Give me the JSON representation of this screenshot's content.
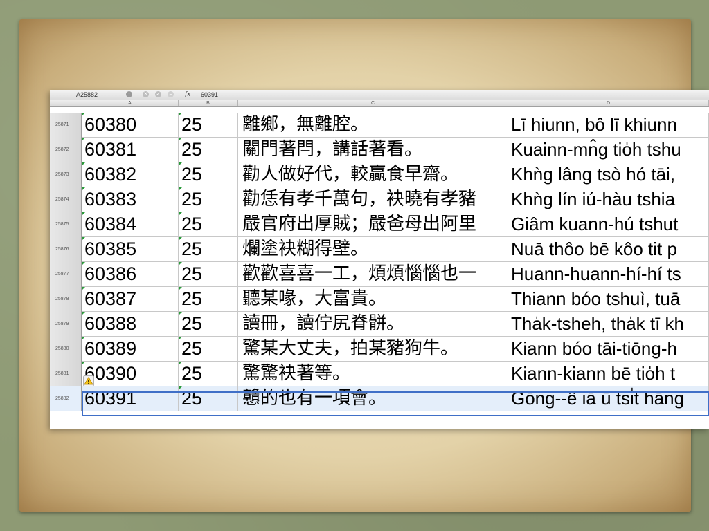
{
  "formula_bar": {
    "name_box": "A25882",
    "fx_label": "fx",
    "value": "60391"
  },
  "columns": [
    "A",
    "B",
    "C",
    "D"
  ],
  "rows": [
    {
      "num": "25871",
      "a": "60380",
      "b": "25",
      "c": "離鄉，無離腔。",
      "d": "Lī hiunn, bô lī khiunn"
    },
    {
      "num": "25872",
      "a": "60381",
      "b": "25",
      "c": "關門著閂，講話著看。",
      "d": "Kuainn-mn̂g tio̍h tshu"
    },
    {
      "num": "25873",
      "a": "60382",
      "b": "25",
      "c": "勸人做好代，較贏食早齋。",
      "d": "Khǹg lâng tsò hó tāi,"
    },
    {
      "num": "25874",
      "a": "60383",
      "b": "25",
      "c": "勸恁有孝千萬句，袂曉有孝豬",
      "d": "Khǹg lín iú-hàu tshia"
    },
    {
      "num": "25875",
      "a": "60384",
      "b": "25",
      "c": "嚴官府出厚賊；嚴爸母出阿里",
      "d": "Giâm kuann-hú tshut"
    },
    {
      "num": "25876",
      "a": "60385",
      "b": "25",
      "c": "爛塗袂糊得壁。",
      "d": "Nuā thôo bē kôo tit p"
    },
    {
      "num": "25877",
      "a": "60386",
      "b": "25",
      "c": "歡歡喜喜一工，煩煩惱惱也一",
      "d": "Huann-huann-hí-hí ts"
    },
    {
      "num": "25878",
      "a": "60387",
      "b": "25",
      "c": "聽某喙，大富貴。",
      "d": "Thiann bóo tshuì, tuā"
    },
    {
      "num": "25879",
      "a": "60388",
      "b": "25",
      "c": "讀冊，讀佇尻脊骿。",
      "d": "Tha̍k-tsheh, tha̍k tī kh"
    },
    {
      "num": "25880",
      "a": "60389",
      "b": "25",
      "c": "驚某大丈夫，拍某豬狗牛。",
      "d": "Kiann bóo tāi-tiōng-h"
    },
    {
      "num": "25881",
      "a": "60390",
      "b": "25",
      "c": "驚驚袂著等。",
      "d": "Kiann-kiann bē tio̍h t"
    },
    {
      "num": "25882",
      "a": "60391",
      "b": "25",
      "c": "戇的也有一項會。",
      "d": "Gōng--ê iā ū tsi̍t hāng"
    }
  ]
}
